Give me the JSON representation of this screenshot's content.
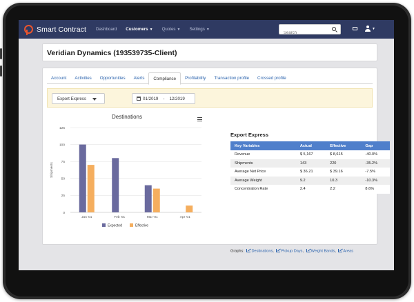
{
  "nav": {
    "brand": "Smart Contract",
    "links": [
      "Dashboard",
      "Customers",
      "Quotes",
      "Settings"
    ],
    "search_placeholder": "Search"
  },
  "page": {
    "title": "Veridian Dynamics (193539735-Client)"
  },
  "tabs": [
    "Account",
    "Activities",
    "Opportunities",
    "Alerts",
    "Compliance",
    "Profitability",
    "Transaction profile",
    "Crossed profile"
  ],
  "active_tab": "Compliance",
  "filters": {
    "dropdown_value": "Export Express",
    "date_from": "01/2019",
    "date_sep": "-",
    "date_to": "12/2019"
  },
  "chart_data": {
    "type": "bar",
    "title": "Destinations",
    "categories": [
      "Jan '01",
      "Feb '01",
      "Mar '01",
      "Apr '01"
    ],
    "series": [
      {
        "name": "Expected",
        "values": [
          100,
          80,
          40,
          0
        ],
        "color": "#6a6a9e"
      },
      {
        "name": "Effective",
        "values": [
          70,
          0,
          35,
          10
        ],
        "color": "#f5ae5e"
      }
    ],
    "ylabel": "Shipments",
    "ylim": [
      0,
      125
    ],
    "yticks": [
      0,
      25,
      50,
      75,
      100,
      125
    ],
    "legend": "bottom",
    "grid": true
  },
  "kv": {
    "title": "Export Express",
    "headers": [
      "Key Variables",
      "Actual",
      "Effective",
      "Gap"
    ],
    "rows": [
      [
        "Revenue",
        "$ 5,167",
        "$ 8,615",
        "-40.0%"
      ],
      [
        "Shipments",
        "143",
        "220",
        "-35.2%"
      ],
      [
        "Average Net Price",
        "$ 36.21",
        "$ 39.16",
        "-7.5%"
      ],
      [
        "Average Weight",
        "9.2",
        "10.3",
        "-10.3%"
      ],
      [
        "Concentration Rate",
        "2.4",
        "2.2",
        "8.6%"
      ]
    ]
  },
  "graphs": {
    "label": "Graphs:",
    "links": [
      "Destinations",
      "Pickup Days",
      "Weight Bands",
      "Areas"
    ]
  },
  "colors": {
    "navbar": "#2f3a62",
    "accent": "#e9542d",
    "table_header": "#4f7fcb"
  }
}
